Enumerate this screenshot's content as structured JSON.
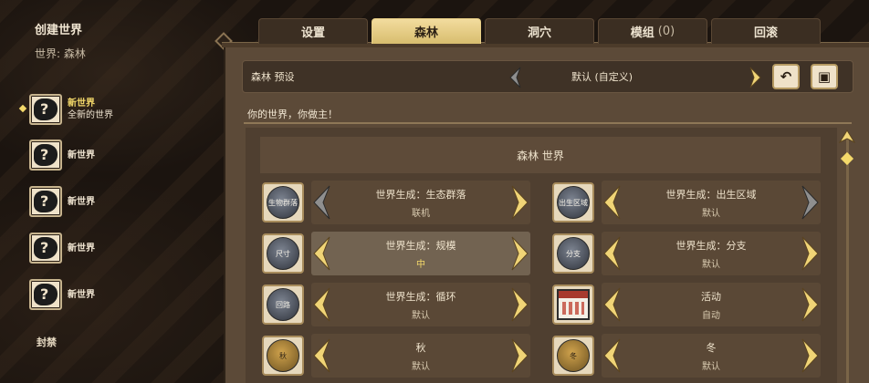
{
  "sidebar": {
    "title": "创建世界",
    "subtitle": "世界: 森林",
    "slots": [
      {
        "name": "新世界",
        "desc": "全新的世界"
      },
      {
        "name": "新世界",
        "desc": ""
      },
      {
        "name": "新世界",
        "desc": ""
      },
      {
        "name": "新世界",
        "desc": ""
      },
      {
        "name": "新世界",
        "desc": ""
      }
    ],
    "lock_label": "封禁"
  },
  "tabs": [
    {
      "label": "设置",
      "count": ""
    },
    {
      "label": "森林",
      "count": ""
    },
    {
      "label": "洞穴",
      "count": ""
    },
    {
      "label": "模组",
      "count": "(0)"
    },
    {
      "label": "回滚",
      "count": ""
    }
  ],
  "active_tab": "森林",
  "preset": {
    "label": "森林 预设",
    "value": "默认 (自定义)"
  },
  "tagline": "你的世界，你做主！",
  "section_title": "森林 世界",
  "settings": [
    {
      "icon_text": "生物群落",
      "label": "世界生成：生态群落",
      "value": "联机",
      "icon": "disc"
    },
    {
      "icon_text": "出生区域",
      "label": "世界生成：出生区域",
      "value": "默认",
      "icon": "disc"
    },
    {
      "icon_text": "尺寸",
      "label": "世界生成：规模",
      "value": "中",
      "icon": "disc"
    },
    {
      "icon_text": "分支",
      "label": "世界生成：分支",
      "value": "默认",
      "icon": "disc"
    },
    {
      "icon_text": "回路",
      "label": "世界生成：循环",
      "value": "默认",
      "icon": "disc"
    },
    {
      "icon_text": "",
      "label": "活动",
      "value": "自动",
      "icon": "calendar"
    },
    {
      "icon_text": "秋",
      "label": "秋",
      "value": "默认",
      "icon": "gold"
    },
    {
      "icon_text": "冬",
      "label": "冬",
      "value": "默认",
      "icon": "gold"
    }
  ],
  "colors": {
    "accent_gold": "#f4d96a",
    "panel": "#5c4a38",
    "tab_active": "#e8cf86"
  }
}
